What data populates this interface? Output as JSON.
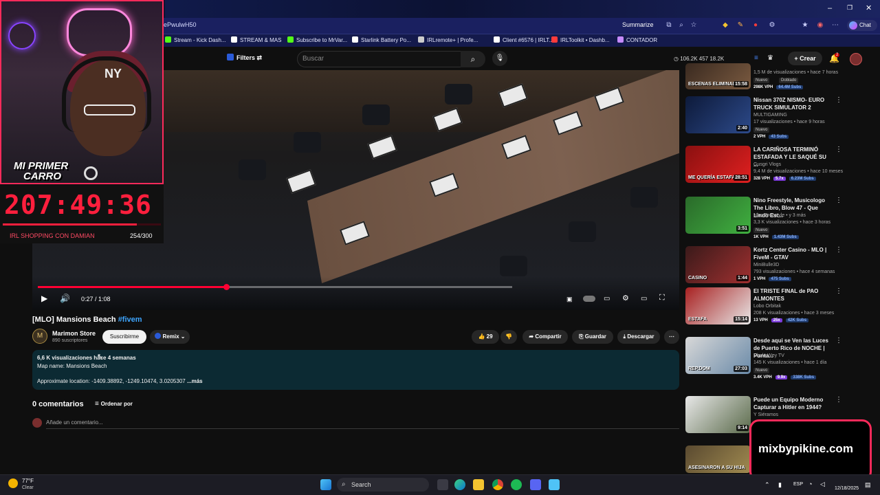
{
  "browser": {
    "url_fragment": "ePwulwH50",
    "summarize_label": "Summarize",
    "chat_label": "Chat",
    "bookmarks": [
      {
        "label": "Stream - Kick Dash...",
        "color": "#53fc18"
      },
      {
        "label": "STREAM & MAS",
        "color": "#ffffff"
      },
      {
        "label": "Subscribe to MrVar...",
        "color": "#53fc18"
      },
      {
        "label": "Starlink Battery Po...",
        "color": "#ffffff"
      },
      {
        "label": "IRLremote+ | Profe...",
        "color": "#cccccc"
      },
      {
        "label": "Client #6576 | IRLT...",
        "color": "#ffffff"
      },
      {
        "label": "IRLToolkit • Dashb...",
        "color": "#ff3b3b"
      },
      {
        "label": "CONTADOR",
        "color": "#c58aff"
      }
    ]
  },
  "youtube_header": {
    "filters_label": "Filters",
    "search_placeholder": "Buscar",
    "stats": "106.2K  457  18.2K",
    "create_label": "Crear",
    "notification_count": "2"
  },
  "video": {
    "current_time": "0:27 / 1:08",
    "progress_fraction": 0.397
  },
  "streamer_overlay": {
    "camera_caption_line1": "MI PRIMER",
    "camera_caption_line2": "CARRO",
    "timer": "207:49:36",
    "goal_label": "IRL SHOPPING CON DAMIAN",
    "goal_count": "254/300",
    "goal_fraction": 0.847,
    "brand": "mixbypikine.com",
    "accent_color": "#ff2a5a"
  },
  "info": {
    "title": "[MLO] Mansions Beach",
    "hashtag": "#fivem",
    "channel_name": "Marimon Store",
    "channel_subs": "890 suscriptores",
    "subscribe_label": "Suscribirme",
    "remix_label": "Remix",
    "likes": "29",
    "share_label": "Compartir",
    "save_label": "Guardar",
    "download_label": "Descargar",
    "desc_line1": "6,6 K visualizaciones  hace 4 semanas",
    "desc_line2": "Map name: Mansions Beach",
    "desc_line3": "Approximate location: -1409.38892, -1249.10474, 3.0205307",
    "desc_more": "...más"
  },
  "comments": {
    "count_label": "0 comentarios",
    "sort_label": "Ordenar por",
    "placeholder": "Añade un comentario..."
  },
  "recommendations": [
    {
      "title": "",
      "thumb_text": "ESCENAS ELIMINAD",
      "duration": "15:58",
      "channel": "",
      "meta": "1,5 M de visualizaciones • hace 7 horas",
      "badge": "Nuevo",
      "badge2": "Doblado",
      "vph": "298K VPH",
      "subs": "64.4M Subs",
      "c1": "#3a2a20",
      "c2": "#7a5a40"
    },
    {
      "title": "Nissan 370Z NISMO- EURO TRUCK SIMULATOR 2",
      "thumb_text": "",
      "duration": "2:40",
      "channel": "MULTIGAMING",
      "meta": "17 visualizaciones • hace 9 horas",
      "badge": "Nuevo",
      "badge2": "",
      "vph": "2 VPH",
      "subs": "43 Subs",
      "c1": "#0d1a3a",
      "c2": "#2d4a8a"
    },
    {
      "title": "LA CARIÑOSA TERMINÓ ESTAFADA Y LE SAQUÉ SU ...",
      "thumb_text": "ME QUERÍA ESTAFAR",
      "duration": "28:51",
      "channel": "Gusgri Vlogs",
      "meta": "9,4 M de visualizaciones • hace 10 meses",
      "badge": "",
      "badge2": "",
      "vph": "328 VPH",
      "vph_badge": "5.7x",
      "subs": "6.23M Subs",
      "c1": "#8a1010",
      "c2": "#e02020"
    },
    {
      "title": "Nino Freestyle, Musicologo The Libro, Blow 47 - Que Lindo Est...",
      "thumb_text": "",
      "duration": "3:51",
      "channel": "Nino Freestyle • y 3 más",
      "meta": "3,3 K visualizaciones • hace 3 horas",
      "badge": "Nuevo",
      "badge2": "",
      "vph": "1K VPH",
      "subs": "1.43M Subs",
      "c1": "#2a6a2a",
      "c2": "#40b040"
    },
    {
      "title": "Kortz Center Casino - MLO | FiveM - GTAV",
      "thumb_text": "CASINO",
      "duration": "1:44",
      "channel": "MiniBulle3D",
      "meta": "793 visualizaciones • hace 4 semanas",
      "badge": "",
      "badge2": "",
      "vph": "1 VPH",
      "subs": "475 Subs",
      "c1": "#3a1a1a",
      "c2": "#a03030"
    },
    {
      "title": "El TRISTE FINAL de PAO ALMONTES",
      "thumb_text": "ESTAFA",
      "duration": "15:14",
      "channel": "Lobo Orbitak",
      "meta": "208 K visualizaciones • hace 3 meses",
      "badge": "",
      "badge2": "",
      "vph": "13 VPH",
      "vph_badge": "25x",
      "subs": "42K Subs",
      "c1": "#a82020",
      "c2": "#e8e8e8"
    },
    {
      "title": "Desde aqui se Ven las Luces de Puerto Rico de NOCHE | Punta...",
      "thumb_text": "REP.DOM",
      "duration": "27:03",
      "channel": "Chulo Wey TV",
      "meta": "145 K visualizaciones • hace 1 día",
      "badge": "Nuevo",
      "badge2": "",
      "vph": "3.4K VPH",
      "vph_badge": "9.9x",
      "subs": "338K Subs",
      "c1": "#d8d8d8",
      "c2": "#6a8aa8"
    },
    {
      "title": "Puede un Equipo Moderno Capturar a Hitler en 1944?",
      "thumb_text": "",
      "duration": "9:14",
      "channel": "Y Siéramos",
      "meta": "",
      "badge": "",
      "badge2": "",
      "vph": "",
      "subs": "",
      "c1": "#e8e8e8",
      "c2": "#5a6a4a"
    },
    {
      "title": "",
      "thumb_text": "ASESINARON A SU HIJA",
      "duration": "",
      "channel": "",
      "meta": "",
      "badge": "",
      "badge2": "",
      "vph": "",
      "subs": "",
      "c1": "#5a4a30",
      "c2": "#a08a50"
    }
  ],
  "taskbar": {
    "temperature": "77°F",
    "condition": "Clear",
    "search_label": "Search",
    "language": "ESP",
    "date": "12/18/2025"
  }
}
